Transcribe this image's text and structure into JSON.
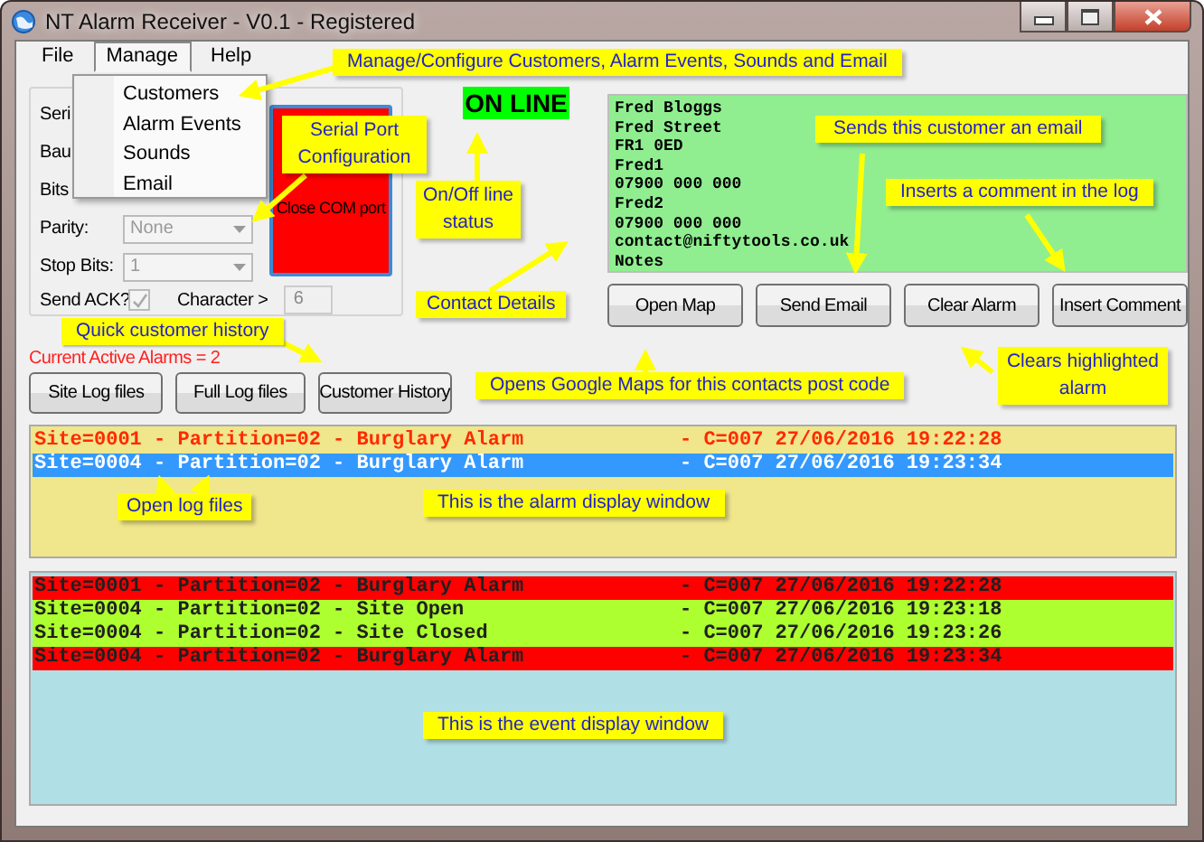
{
  "window": {
    "title": "NT Alarm Receiver - V0.1 - Registered"
  },
  "menu_bar": [
    {
      "label": "File",
      "selected": false
    },
    {
      "label": "Manage",
      "selected": true
    },
    {
      "label": "Help",
      "selected": false
    }
  ],
  "dropdown_menu": {
    "items": [
      "Customers",
      "Alarm Events",
      "Sounds",
      "Email"
    ]
  },
  "serial_panel": {
    "fields": [
      {
        "kind": "label",
        "label": "Seri"
      },
      {
        "kind": "label",
        "label": "Bau"
      },
      {
        "kind": "label",
        "label": "Bits"
      },
      {
        "kind": "combo",
        "label": "Parity:",
        "value": "None",
        "disabled": true
      },
      {
        "kind": "combo",
        "label": "Stop Bits:",
        "value": "1",
        "disabled": true
      }
    ],
    "send_ack": {
      "label": "Send ACK?",
      "checked": true,
      "disabled": true
    },
    "character": {
      "label": "Character >",
      "value": "6",
      "disabled": true
    },
    "port_button": {
      "label": "Close COM port"
    }
  },
  "status": {
    "label": "ON LINE",
    "online": true
  },
  "contact_details": [
    "Fred Bloggs",
    "Fred Street",
    "FR1 0ED",
    "Fred1",
    "07900 000 000",
    "Fred2",
    "07900 000 000",
    "contact@niftytools.co.uk",
    "Notes"
  ],
  "action_buttons": [
    "Open Map",
    "Send Email",
    "Clear Alarm",
    "Insert Comment"
  ],
  "active_alarms": "Current Active Alarms = 2",
  "log_buttons": [
    "Site Log files",
    "Full Log files",
    "Customer History"
  ],
  "alarm_list": [
    {
      "event": "Site=0001 - Partition=02 - Burglary Alarm",
      "detail": "- C=007 27/06/2016 19:22:28",
      "selected": false
    },
    {
      "event": "Site=0004 - Partition=02 - Burglary Alarm",
      "detail": "- C=007 27/06/2016 19:23:34",
      "selected": true
    }
  ],
  "event_list": [
    {
      "event": "Site=0001 - Partition=02 - Burglary Alarm",
      "detail": "- C=007 27/06/2016 19:22:28",
      "color": "#ff0000"
    },
    {
      "event": "Site=0004 - Partition=02 - Site Open",
      "detail": "- C=007 27/06/2016 19:23:18",
      "color": "#adff2f"
    },
    {
      "event": "Site=0004 - Partition=02 - Site Closed",
      "detail": "- C=007 27/06/2016 19:23:26",
      "color": "#adff2f"
    },
    {
      "event": "Site=0004 - Partition=02 - Burglary Alarm",
      "detail": "- C=007 27/06/2016 19:23:34",
      "color": "#ff0000"
    }
  ],
  "callouts": [
    "Manage/Configure Customers, Alarm Events, Sounds and Email",
    "Serial Port Configuration",
    "On/Off line status",
    "Contact Details",
    "Sends this customer an email",
    "Inserts a comment in the log",
    "Clears highlighted alarm",
    "Quick customer history",
    "Opens Google Maps for this contacts post code",
    "Open log files",
    "This is the alarm display window",
    "This is the event display window"
  ]
}
